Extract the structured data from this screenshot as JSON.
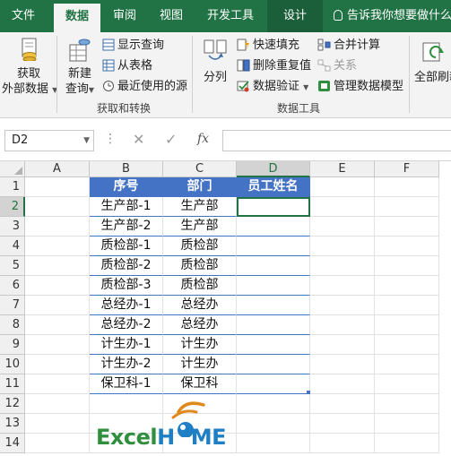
{
  "tabs": [
    {
      "label": "文件",
      "active": false
    },
    {
      "label": "数据",
      "active": true
    },
    {
      "label": "审阅",
      "active": false
    },
    {
      "label": "视图",
      "active": false
    },
    {
      "label": "开发工具",
      "active": false
    },
    {
      "label": "设计",
      "active": false
    }
  ],
  "tell_me": "告诉我你想要做什么",
  "ribbon": {
    "get_external_data": {
      "line1": "获取",
      "line2": "外部数据"
    },
    "new_query": {
      "line1": "新建",
      "line2": "查询"
    },
    "show_queries": "显示查询",
    "from_table": "从表格",
    "recent_sources": "最近使用的源",
    "group_get_transform": "获取和转换",
    "split": "分列",
    "flash_fill": "快速填充",
    "remove_duplicates": "删除重复值",
    "data_validation": "数据验证",
    "consolidate": "合并计算",
    "relationships": "关系",
    "manage_data_model": "管理数据模型",
    "group_data_tools": "数据工具",
    "refresh_all": "全部刷新"
  },
  "formula_bar": {
    "name_box": "D2",
    "cancel": "✕",
    "enter": "✓",
    "fx": "fx",
    "content": ""
  },
  "columns": [
    "A",
    "B",
    "C",
    "D",
    "E",
    "F"
  ],
  "rows": [
    "1",
    "2",
    "3",
    "4",
    "5",
    "6",
    "7",
    "8",
    "9",
    "10",
    "11",
    "12",
    "13",
    "14"
  ],
  "table": {
    "headers": [
      "序号",
      "部门",
      "员工姓名"
    ],
    "rows": [
      [
        "生产部-1",
        "生产部",
        ""
      ],
      [
        "生产部-2",
        "生产部",
        ""
      ],
      [
        "质检部-1",
        "质检部",
        ""
      ],
      [
        "质检部-2",
        "质检部",
        ""
      ],
      [
        "质检部-3",
        "质检部",
        ""
      ],
      [
        "总经办-1",
        "总经办",
        ""
      ],
      [
        "总经办-2",
        "总经办",
        ""
      ],
      [
        "计生办-1",
        "计生办",
        ""
      ],
      [
        "计生办-2",
        "计生办",
        ""
      ],
      [
        "保卫科-1",
        "保卫科",
        ""
      ]
    ]
  },
  "logo": {
    "part1": "Excel",
    "part2": "H",
    "part3": "ME"
  },
  "colors": {
    "accent": "#217346",
    "table_header": "#4472c4"
  }
}
